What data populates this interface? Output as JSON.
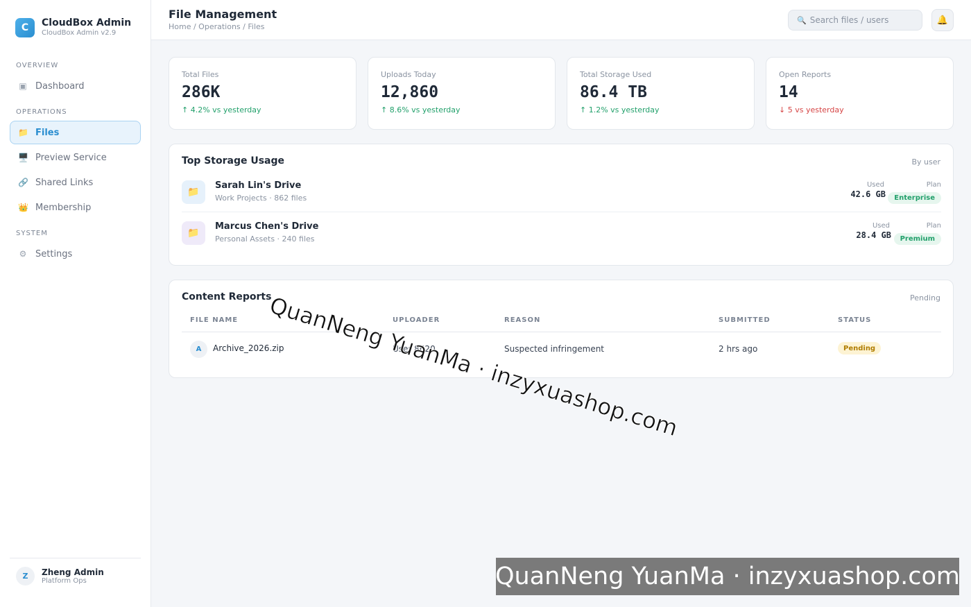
{
  "brand": {
    "logo_letter": "C",
    "name": "CloudBox Admin",
    "version": "CloudBox Admin v2.9"
  },
  "sidebar": {
    "sections": [
      "OVERVIEW",
      "OPERATIONS",
      "SYSTEM"
    ],
    "items": [
      {
        "label": "Dashboard",
        "icon": "▣",
        "icon_name": "dashboard-icon"
      },
      {
        "label": "Files",
        "icon": "📁",
        "icon_name": "folder-icon",
        "active": true
      },
      {
        "label": "Preview Service",
        "icon": "🖥️",
        "icon_name": "monitor-icon"
      },
      {
        "label": "Shared Links",
        "icon": "🔗",
        "icon_name": "link-icon"
      },
      {
        "label": "Membership",
        "icon": "👑",
        "icon_name": "crown-icon"
      },
      {
        "label": "Settings",
        "icon": "⚙",
        "icon_name": "gear-icon"
      }
    ]
  },
  "user": {
    "initial": "Z",
    "name": "Zheng Admin",
    "role": "Platform Ops"
  },
  "header": {
    "title": "File Management",
    "breadcrumb": "Home / Operations / Files",
    "search_placeholder": "Search files / users",
    "search_icon": "🔍",
    "bell_icon": "🔔"
  },
  "stats": [
    {
      "label": "Total Files",
      "value": "286K",
      "delta": "↑ 4.2% vs yesterday",
      "trend": "up"
    },
    {
      "label": "Uploads Today",
      "value": "12,860",
      "delta": "↑ 8.6% vs yesterday",
      "trend": "up"
    },
    {
      "label": "Total Storage Used",
      "value": "86.4 TB",
      "delta": "↑ 1.2% vs yesterday",
      "trend": "up"
    },
    {
      "label": "Open Reports",
      "value": "14",
      "delta": "↓ 5 vs yesterday",
      "trend": "down"
    }
  ],
  "storage": {
    "title": "Top Storage Usage",
    "hint": "By user",
    "used_label": "Used",
    "plan_label": "Plan",
    "rows": [
      {
        "name": "Sarah Lin's Drive",
        "meta": "Work Projects · 862 files",
        "used": "42.6 GB",
        "plan": "Enterprise",
        "icon": "📁"
      },
      {
        "name": "Marcus Chen's Drive",
        "meta": "Personal Assets · 240 files",
        "used": "28.4 GB",
        "plan": "Premium",
        "icon": "📁"
      }
    ]
  },
  "reports": {
    "title": "Content Reports",
    "hint": "Pending",
    "columns": [
      "FILE NAME",
      "UPLOADER",
      "REASON",
      "SUBMITTED",
      "STATUS"
    ],
    "rows": [
      {
        "initial": "A",
        "file": "Archive_2026.zip",
        "uploader": "User 8620",
        "reason": "Suspected infringement",
        "submitted": "2 hrs ago",
        "status": "Pending"
      }
    ]
  },
  "watermark": {
    "text": "QuanNeng YuanMa · inzyxuashop.com"
  },
  "colors": {
    "accent": "#2b8ed0",
    "positive": "#22a06b",
    "negative": "#d64545",
    "pending": "#b07d00"
  }
}
